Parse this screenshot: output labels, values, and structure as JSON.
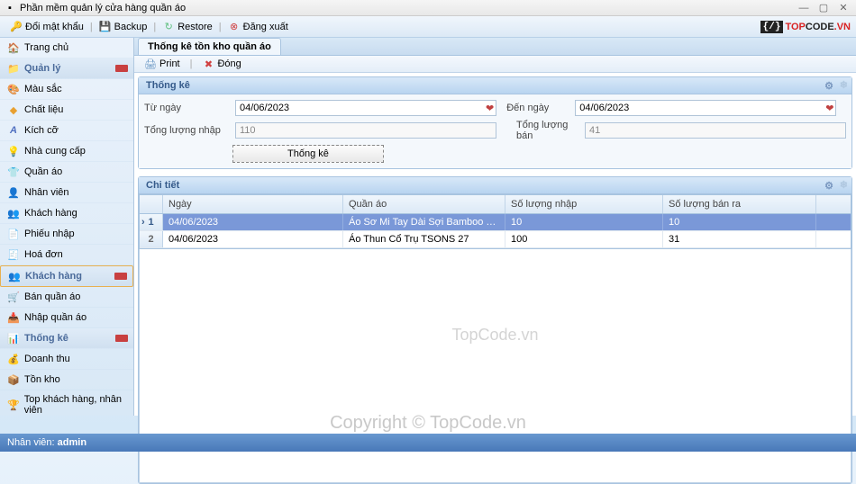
{
  "window": {
    "title": "Phần mềm quản lý cửa hàng quần áo"
  },
  "toolbar": {
    "change_password": "Đổi mật khẩu",
    "backup": "Backup",
    "restore": "Restore",
    "logout": "Đăng xuất"
  },
  "logo": {
    "top": "TOP",
    "code": "CODE",
    "domain": ".VN"
  },
  "tabs": {
    "active": "Thống kê tồn kho quần áo"
  },
  "sidebar": {
    "home": "Trang chủ",
    "mgmt": "Quản lý",
    "color": "Màu sắc",
    "material": "Chất liệu",
    "size": "Kích cỡ",
    "supplier": "Nhà cung cấp",
    "clothes": "Quần áo",
    "staff": "Nhân viên",
    "customer": "Khách hàng",
    "receipt": "Phiếu nhập",
    "invoice": "Hoá đơn",
    "customer_header": "Khách hàng",
    "sell": "Bán quần áo",
    "import": "Nhập quần áo",
    "stats": "Thống kê",
    "revenue": "Doanh thu",
    "stock": "Tồn kho",
    "top": "Top khách hàng, nhân viên"
  },
  "content_toolbar": {
    "print": "Print",
    "close": "Đóng"
  },
  "panel_stats": {
    "title": "Thống kê",
    "from_label": "Từ ngày",
    "from_value": "04/06/2023",
    "to_label": "Đến ngày",
    "to_value": "04/06/2023",
    "total_in_label": "Tổng lượng nhập",
    "total_in_value": "110",
    "total_out_label": "Tổng lượng bán",
    "total_out_value": "41",
    "button": "Thống kê"
  },
  "panel_detail": {
    "title": "Chi tiết",
    "columns": {
      "date": "Ngày",
      "product": "Quần áo",
      "qty_in": "Số lượng nhập",
      "qty_out": "Số lượng bán ra"
    },
    "rows": [
      {
        "n": "1",
        "date": "04/06/2023",
        "product": "Áo Sơ Mi Tay Dài Sợi Bamboo Đơn Giản Y Ngu...",
        "in": "10",
        "out": "10"
      },
      {
        "n": "2",
        "date": "04/06/2023",
        "product": "Áo Thun Cổ Trụ TSONS 27",
        "in": "100",
        "out": "31"
      }
    ]
  },
  "watermarks": {
    "center": "TopCode.vn",
    "bottom": "Copyright © TopCode.vn"
  },
  "statusbar": {
    "user_label": "Nhân viên:",
    "user_value": "admin"
  }
}
